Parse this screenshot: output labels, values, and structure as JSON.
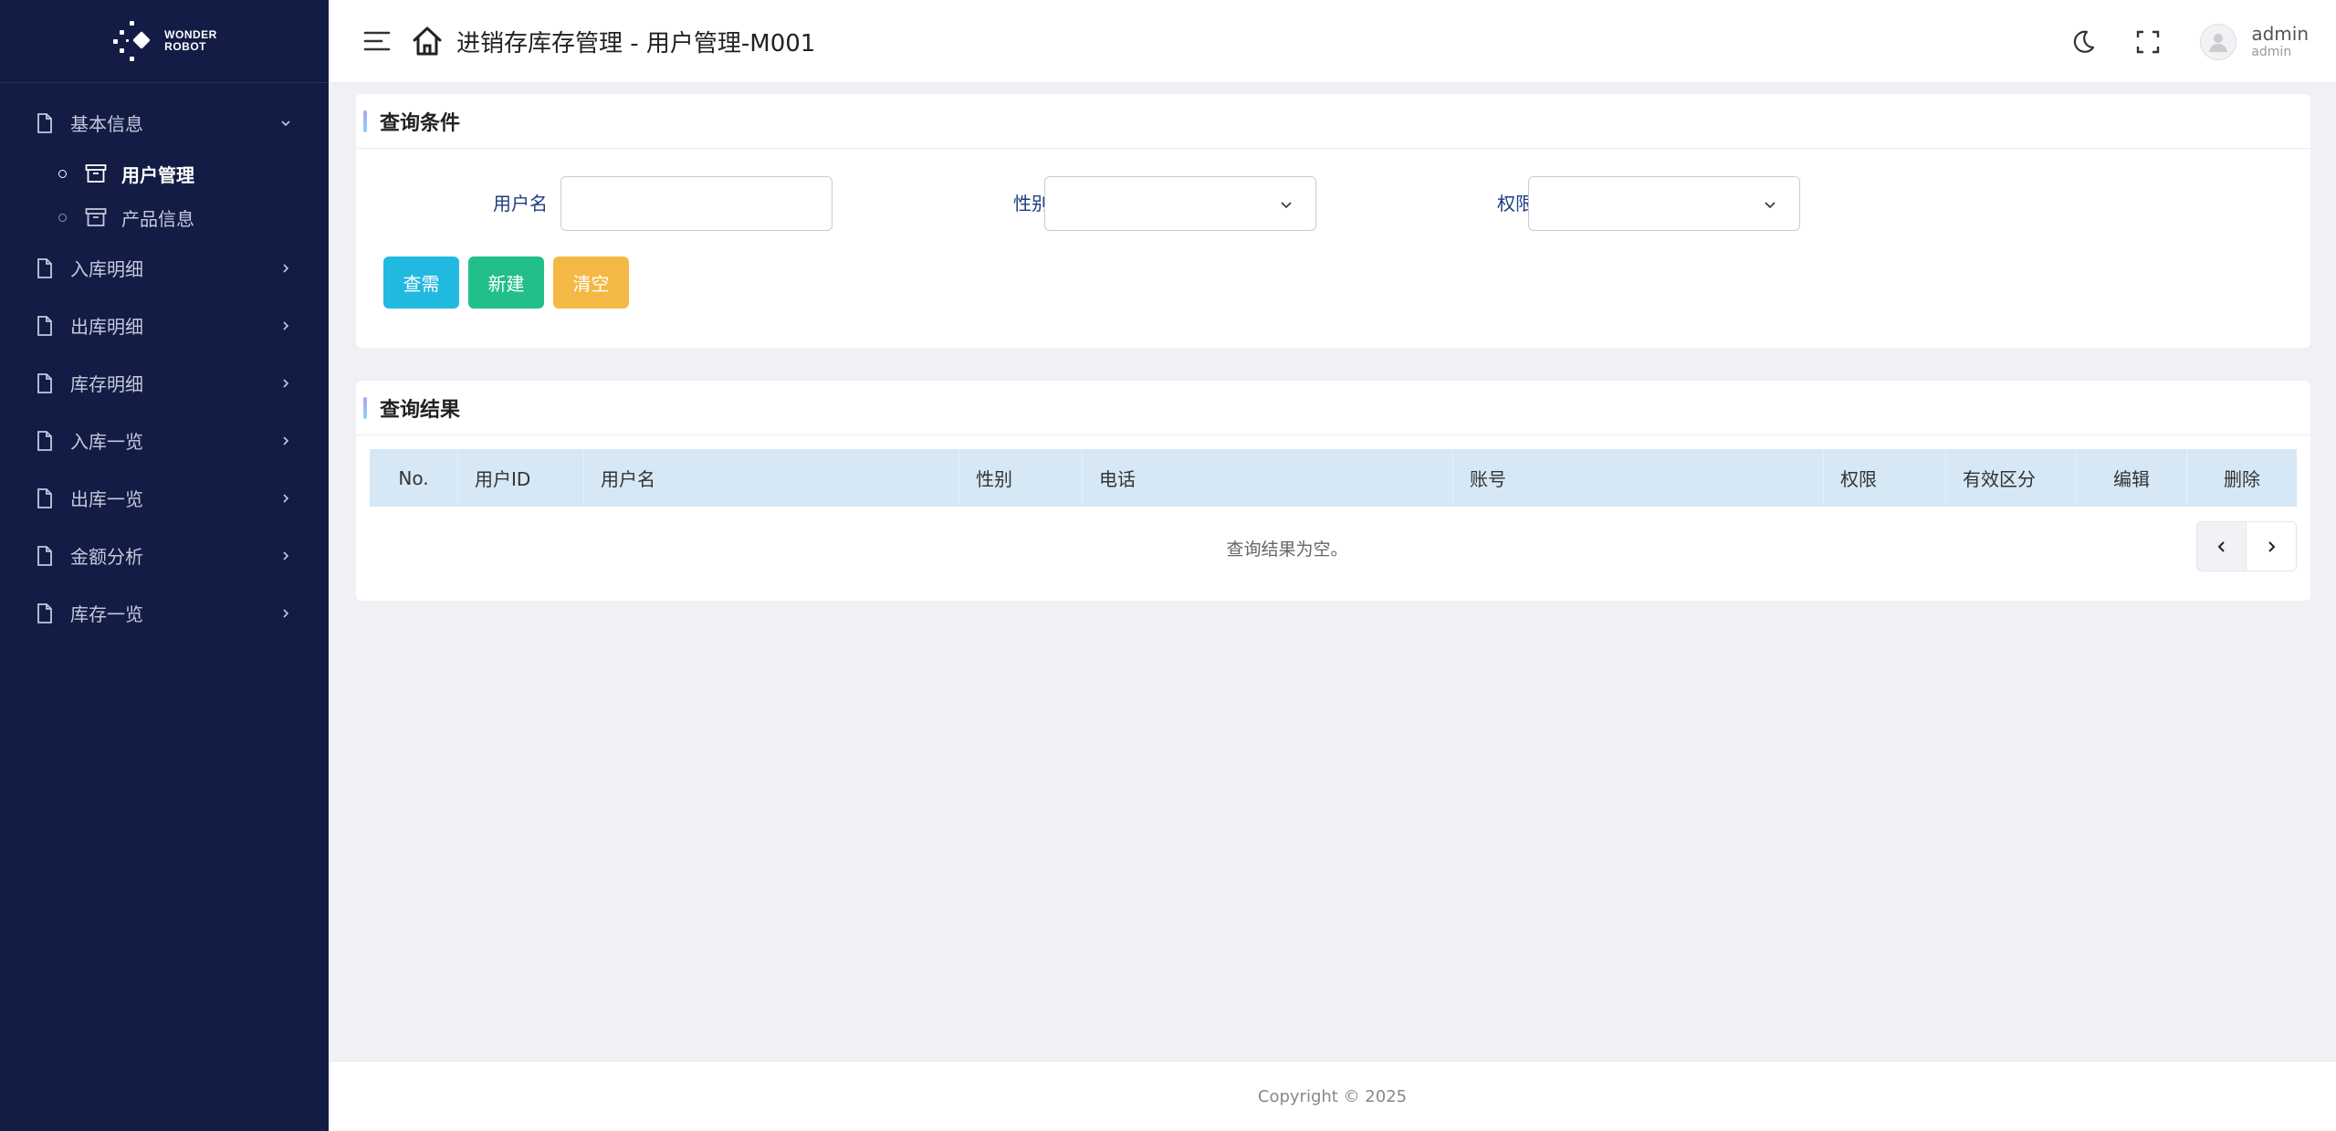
{
  "logo": {
    "line1": "WONDER",
    "line2": "ROBOT"
  },
  "sidebar": {
    "groups": [
      {
        "label": "基本信息",
        "expanded": true,
        "icon": "file-icon"
      },
      {
        "label": "入库明细",
        "icon": "file-icon"
      },
      {
        "label": "出库明细",
        "icon": "file-icon"
      },
      {
        "label": "库存明细",
        "icon": "file-icon"
      },
      {
        "label": "入库一览",
        "icon": "file-icon"
      },
      {
        "label": "出库一览",
        "icon": "file-icon"
      },
      {
        "label": "金额分析",
        "icon": "file-icon"
      },
      {
        "label": "库存一览",
        "icon": "file-icon"
      }
    ],
    "sub_items": [
      {
        "label": "用户管理",
        "active": true,
        "icon": "archive-icon"
      },
      {
        "label": "产品信息",
        "active": false,
        "icon": "archive-icon"
      }
    ]
  },
  "header": {
    "title": "进销存库存管理 - 用户管理-M001",
    "user_name": "admin",
    "user_role": "admin"
  },
  "search_panel": {
    "title": "查询条件",
    "username_label": "用户名",
    "username_value": "",
    "gender_label": "性别",
    "gender_value": "",
    "permission_label": "权限",
    "permission_value": "",
    "buttons": {
      "search": "查需",
      "new": "新建",
      "clear": "清空"
    }
  },
  "result_panel": {
    "title": "查询结果",
    "columns": [
      "No.",
      "用户ID",
      "用户名",
      "性别",
      "电话",
      "账号",
      "权限",
      "有效区分",
      "编辑",
      "删除"
    ],
    "rows": [],
    "empty_text": "查询结果为空。"
  },
  "footer": {
    "copyright": "Copyright © 2025"
  },
  "colors": {
    "sidebar_bg": "#121c44",
    "search_btn": "#22b9e1",
    "new_btn": "#22bf8c",
    "clear_btn": "#f4b945",
    "table_head_bg": "#d6e8f6"
  }
}
